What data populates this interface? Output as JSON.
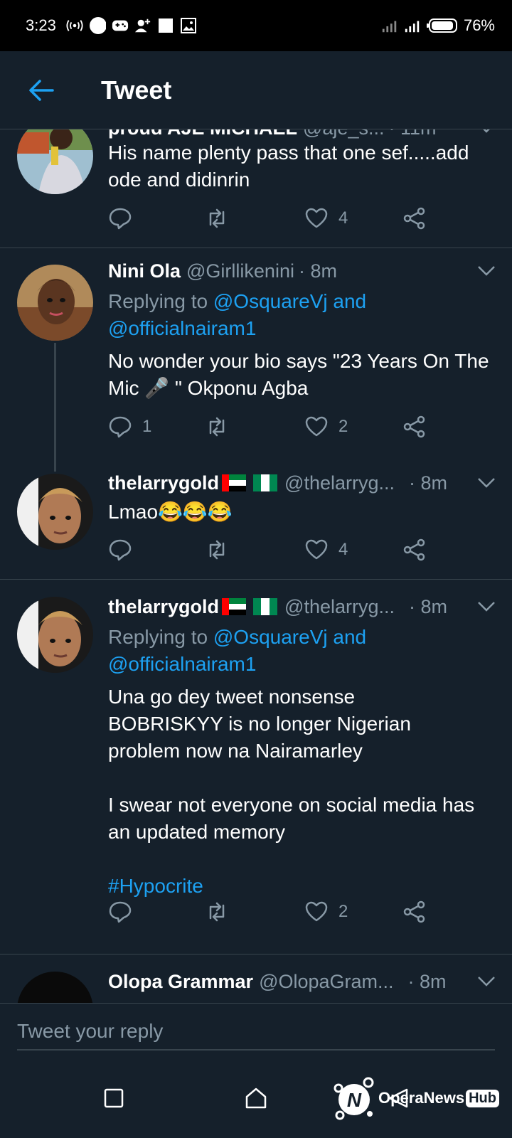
{
  "status_bar": {
    "time": "3:23",
    "battery_percent": "76%"
  },
  "header": {
    "title": "Tweet"
  },
  "tweets": [
    {
      "name": "proud AJE MICHAEL",
      "handle": "@aje_s...",
      "time": "· 11m",
      "body": "His name plenty pass that one sef.....add ode and didinrin",
      "reply_count": "",
      "like_count": "4"
    },
    {
      "name": "Nini Ola",
      "handle": "@Girllikenini",
      "time": "· 8m",
      "replying_prefix": "Replying to ",
      "replying_to_1": "@OsquareVj and",
      "replying_to_2": "@officialnairam1",
      "body": "No wonder your bio says \"23 Years On The Mic 🎤 \" Okponu Agba",
      "reply_count": "1",
      "like_count": "2"
    },
    {
      "name": "thelarrygold",
      "handle": "@thelarryg...",
      "time": "· 8m",
      "body": "Lmao😂😂😂",
      "reply_count": "",
      "like_count": "4"
    },
    {
      "name": "thelarrygold",
      "handle": "@thelarryg...",
      "time": "· 8m",
      "replying_prefix": "Replying to ",
      "replying_to_1": "@OsquareVj and",
      "replying_to_2": "@officialnairam1",
      "body_p1": "Una go dey tweet nonsense BOBRISKYY is no longer Nigerian problem now na Nairamarley",
      "body_p2": "I swear not everyone on social media has an updated memory",
      "hashtag": "#Hypocrite",
      "reply_count": "",
      "like_count": "2"
    },
    {
      "name": "Olopa Grammar",
      "handle": "@OlopaGram...",
      "time": "· 8m"
    }
  ],
  "reply_bar": {
    "placeholder": "Tweet your reply"
  },
  "watermark": {
    "text": "OperaNews",
    "badge": "Hub"
  },
  "colors": {
    "background": "#15202b",
    "accent": "#1da1f2",
    "secondary_text": "#8899a6",
    "divider": "#38444d"
  }
}
